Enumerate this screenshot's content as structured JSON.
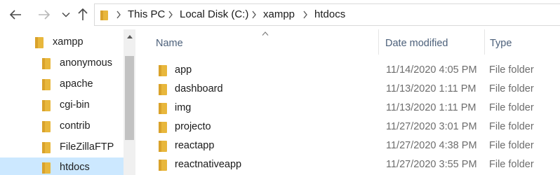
{
  "nav": {
    "back": "back-arrow-icon",
    "forward": "forward-arrow-icon",
    "recent": "chevron-down-icon",
    "up": "up-arrow-icon"
  },
  "address": {
    "crumbs": [
      "This PC",
      "Local Disk (C:)",
      "xampp",
      "htdocs"
    ]
  },
  "tree": {
    "items": [
      {
        "label": "xampp"
      },
      {
        "label": "anonymous"
      },
      {
        "label": "apache"
      },
      {
        "label": "cgi-bin"
      },
      {
        "label": "contrib"
      },
      {
        "label": "FileZillaFTP"
      },
      {
        "label": "htdocs",
        "selected": true
      }
    ]
  },
  "list": {
    "columns": {
      "name": "Name",
      "date": "Date modified",
      "type": "Type"
    },
    "rows": [
      {
        "name": "app",
        "date": "11/14/2020 4:05 PM",
        "type": "File folder"
      },
      {
        "name": "dashboard",
        "date": "11/13/2020 1:11 PM",
        "type": "File folder"
      },
      {
        "name": "img",
        "date": "11/13/2020 1:11 PM",
        "type": "File folder"
      },
      {
        "name": "projecto",
        "date": "11/27/2020 3:01 PM",
        "type": "File folder"
      },
      {
        "name": "reactapp",
        "date": "11/27/2020 4:38 PM",
        "type": "File folder"
      },
      {
        "name": "reactnativeapp",
        "date": "11/27/2020 3:55 PM",
        "type": "File folder"
      }
    ]
  },
  "colors": {
    "folder": "#e8b73c",
    "folder_dark": "#d9a22b",
    "selected_bg": "#cce8ff",
    "header_text": "#4c607a"
  }
}
